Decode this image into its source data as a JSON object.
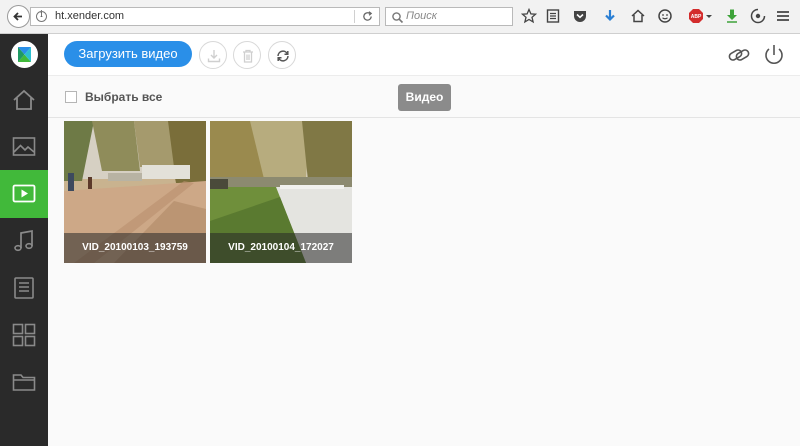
{
  "browser": {
    "url": "ht.xender.com",
    "search_placeholder": "Поиск",
    "icons": [
      "back-arrow-icon",
      "info-icon",
      "reload-icon",
      "search-icon",
      "star-icon",
      "reading-list-icon",
      "pocket-icon",
      "download-icon",
      "home-icon",
      "chat-icon",
      "adblock-icon",
      "green-download-icon",
      "sync-icon"
    ]
  },
  "sidebar": {
    "logo": "xender-logo",
    "items": [
      {
        "name": "home",
        "icon": "home-icon"
      },
      {
        "name": "photos",
        "icon": "image-icon"
      },
      {
        "name": "videos",
        "icon": "play-icon",
        "active": true
      },
      {
        "name": "music",
        "icon": "music-note-icon"
      },
      {
        "name": "documents",
        "icon": "document-icon"
      },
      {
        "name": "apps",
        "icon": "grid-icon"
      },
      {
        "name": "files",
        "icon": "folder-icon"
      }
    ],
    "accent": "#41b93a"
  },
  "toolbar": {
    "upload_label": "Загрузить видео",
    "upload_color": "#2a8fe8",
    "icons": [
      "download-icon",
      "trash-icon",
      "refresh-icon",
      "link-icon",
      "power-icon"
    ]
  },
  "subbar": {
    "select_all_label": "Выбрать все",
    "active_tab_label": "Видео"
  },
  "videos": [
    {
      "caption": "VID_20100103_193759"
    },
    {
      "caption": "VID_20100104_172027"
    }
  ]
}
